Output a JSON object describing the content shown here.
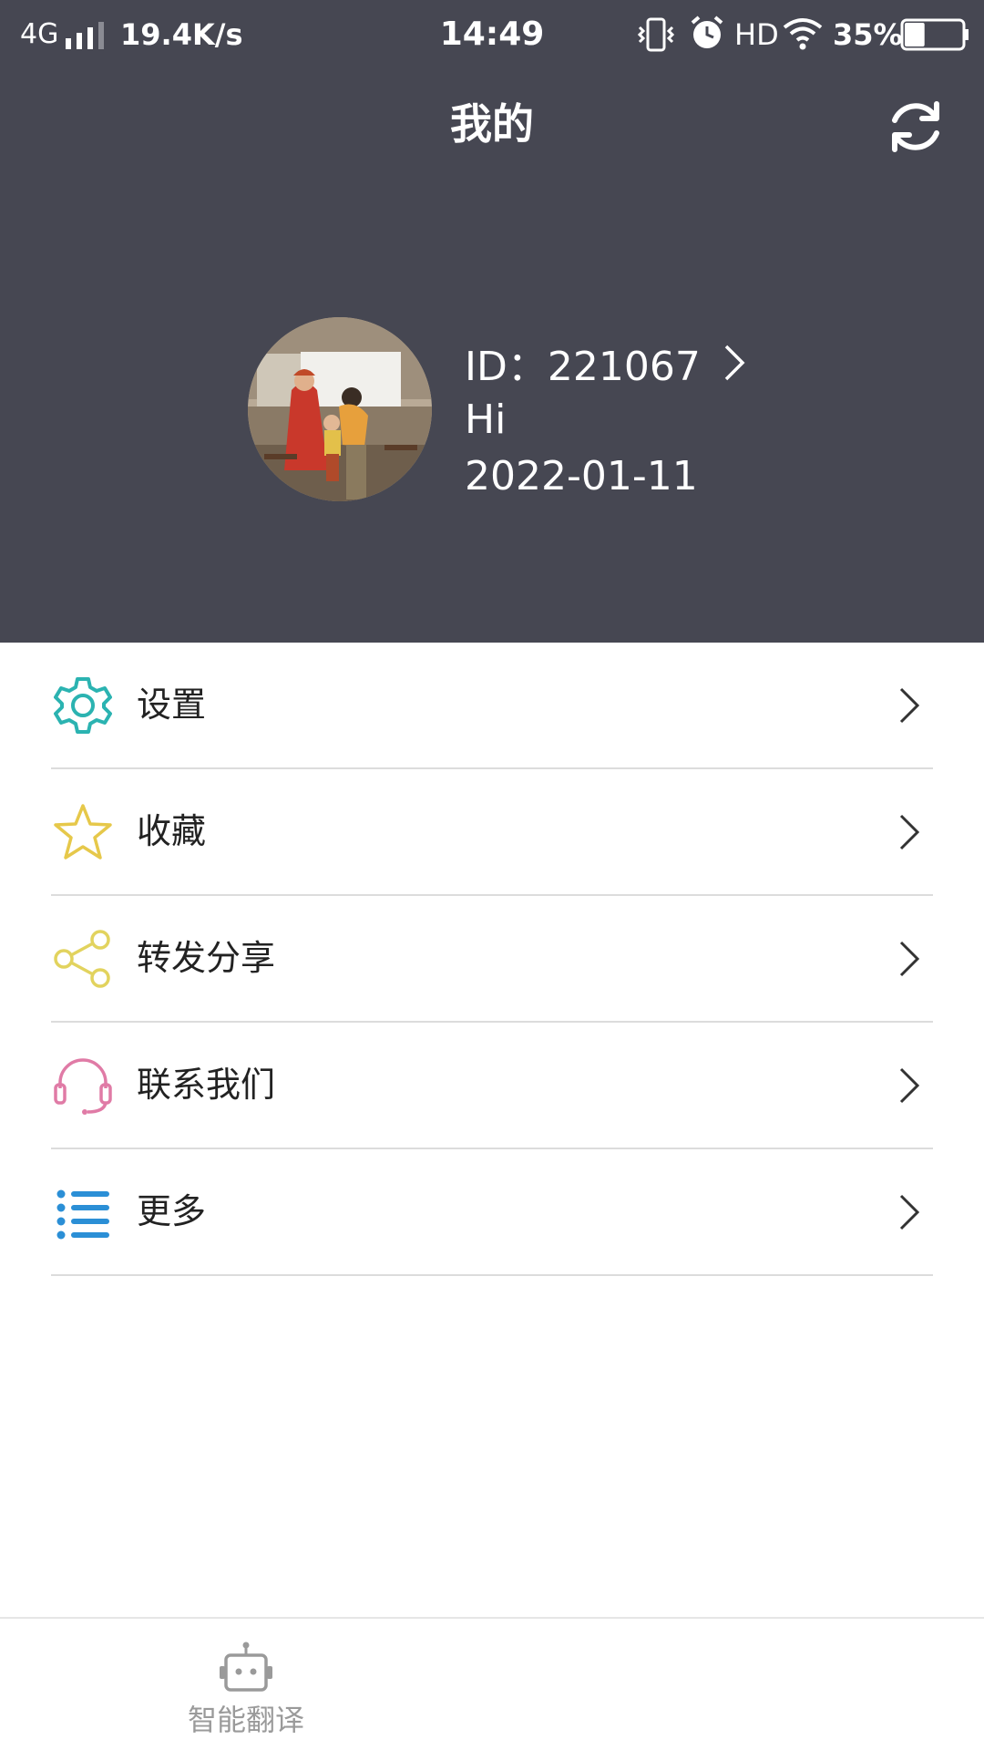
{
  "status_bar": {
    "network": "4G",
    "speed": "19.4K/s",
    "time": "14:49",
    "hd": "HD",
    "battery": "35%",
    "battery_level": 0.35
  },
  "header": {
    "title": "我的",
    "refresh_icon": "refresh-icon"
  },
  "profile": {
    "id_text": "ID：221067",
    "greeting": "Hi",
    "date": "2022-01-11"
  },
  "menu": {
    "items": [
      {
        "label": "设置",
        "icon": "gear-icon",
        "color": "#2bb3b1"
      },
      {
        "label": "收藏",
        "icon": "star-icon",
        "color": "#e6c84a"
      },
      {
        "label": "转发分享",
        "icon": "share-icon",
        "color": "#e2d35e"
      },
      {
        "label": "联系我们",
        "icon": "headset-icon",
        "color": "#e07ba6"
      },
      {
        "label": "更多",
        "icon": "list-icon",
        "color": "#2b8fd6"
      }
    ]
  },
  "bottom_nav": {
    "tabs": [
      {
        "label": "智能翻译",
        "icon": "robot-icon"
      }
    ]
  },
  "colors": {
    "header_bg": "#464752",
    "divider": "#dcdcdc",
    "text": "#222222",
    "nav_text": "#9a9a9a"
  }
}
